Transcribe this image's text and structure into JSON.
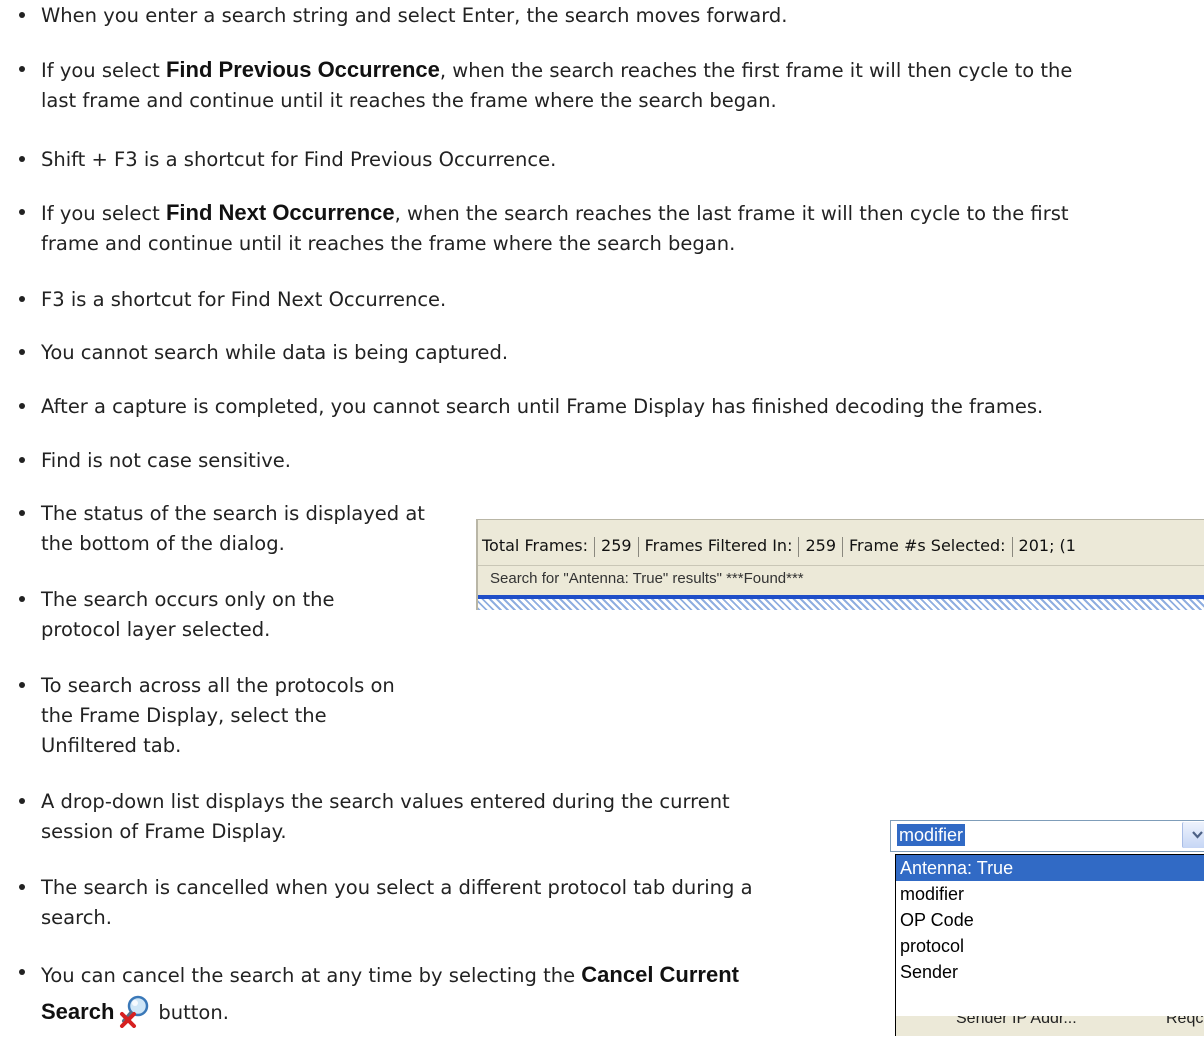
{
  "bullets": [
    {
      "text": "When you enter a search string and select Enter, the search moves forward."
    },
    {
      "pre": "If you select ",
      "bold": "Find Previous Occurrence",
      "post": ", when the search reaches the first frame it will then cycle to the\nlast frame and continue until it reaches the frame where the search began."
    },
    {
      "text": "Shift + F3 is a shortcut for Find Previous Occurrence."
    },
    {
      "pre": "If you select ",
      "bold": "Find Next Occurrence",
      "post": ", when the search reaches the last frame it will then cycle to the first\nframe and continue until it reaches the frame where the search began."
    },
    {
      "text": "F3 is a shortcut for Find Next Occurrence."
    },
    {
      "text": "You cannot search while data is being captured."
    },
    {
      "text": "After a capture is completed, you cannot search until Frame Display has finished decoding the frames."
    },
    {
      "text": "Find is not case sensitive."
    },
    {
      "text": "The status of the search is displayed at\nthe bottom of the dialog."
    },
    {
      "text": "The search occurs only on the\nprotocol layer selected."
    },
    {
      "text": "To search across all the protocols on\nthe Frame Display, select the\nUnfiltered tab."
    },
    {
      "text": "A drop-down list displays the search values entered during the current\nsession of Frame Display."
    },
    {
      "text": "The search is cancelled when you select a different protocol tab during a\nsearch."
    },
    {
      "pre": "You can cancel the search at any time by selecting the ",
      "bold": "Cancel Current",
      "bold2": "Search",
      "post": "button."
    }
  ],
  "status_figure": {
    "total_label": "Total Frames:",
    "total_value": "259",
    "filtered_label": "Frames Filtered In:",
    "filtered_value": "259",
    "selected_label": "Frame #s Selected:",
    "selected_value": "201; (1",
    "message": "Search for \"Antenna: True\" results\" ***Found***"
  },
  "dropdown_figure": {
    "current_value": "modifier",
    "options": [
      "Antenna: True",
      "modifier",
      "OP Code",
      "protocol",
      "Sender"
    ],
    "selected_option": "Antenna: True",
    "behind_text_1": "Sender IP Addr...",
    "behind_text_2": "Reqc"
  },
  "icons": {
    "cancel_search": "cancel-search-icon",
    "dropdown_arrow": "chevron-down-icon"
  },
  "colors": {
    "selection": "#316ac5",
    "statusbar": "#ece9d8",
    "accent_bar": "#1f4ec8"
  }
}
